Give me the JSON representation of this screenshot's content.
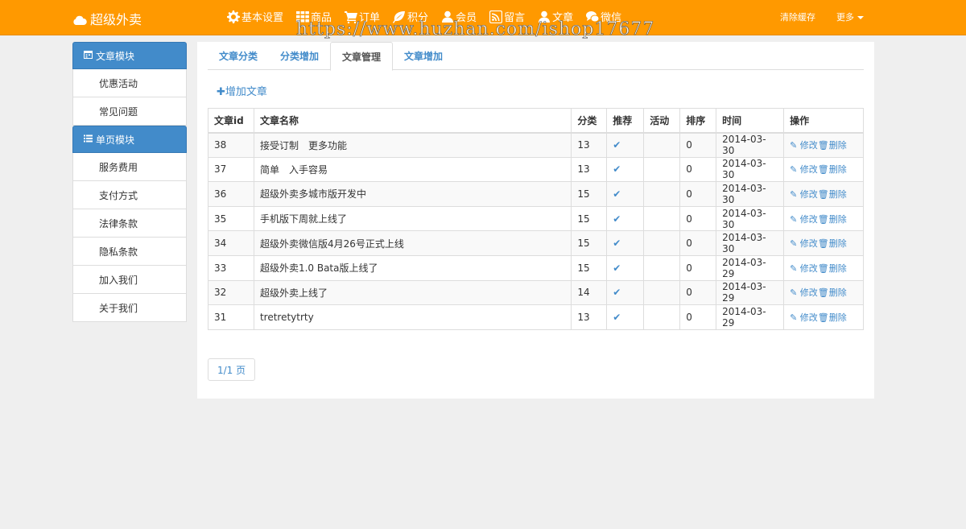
{
  "brand": {
    "name": "超级外卖",
    "icon": "cloud-icon"
  },
  "nav": [
    {
      "label": "基本设置",
      "icon": "gear-icon"
    },
    {
      "label": "商品",
      "icon": "grid-icon"
    },
    {
      "label": "订单",
      "icon": "cart-icon"
    },
    {
      "label": "积分",
      "icon": "leaf-icon"
    },
    {
      "label": "会员",
      "icon": "user-icon"
    },
    {
      "label": "留言",
      "icon": "rss-icon"
    },
    {
      "label": "文章",
      "icon": "user-icon"
    },
    {
      "label": "微信",
      "icon": "chat-icon"
    }
  ],
  "nav_right": {
    "clear_cache": "清除缓存",
    "more": "更多"
  },
  "watermark": "https://www.huzhan.com/ishop17677",
  "sidebar": {
    "group1": {
      "title": "文章模块",
      "icon": "calendar-icon",
      "items": [
        "优惠活动",
        "常见问题"
      ]
    },
    "group2": {
      "title": "单页模块",
      "icon": "list-icon",
      "items": [
        "服务费用",
        "支付方式",
        "法律条款",
        "隐私条款",
        "加入我们",
        "关于我们"
      ]
    }
  },
  "tabs": [
    "文章分类",
    "分类增加",
    "文章管理",
    "文章增加"
  ],
  "active_tab": "文章管理",
  "add_article": "增加文章",
  "table": {
    "headers": [
      "文章id",
      "文章名称",
      "分类",
      "推荐",
      "活动",
      "排序",
      "时间",
      "操作"
    ],
    "rows": [
      {
        "id": "38",
        "name": "接受订制　更多功能",
        "category": "13",
        "recommend": true,
        "activity": "",
        "order": "0",
        "time": "2014-03-30"
      },
      {
        "id": "37",
        "name": "简单　入手容易",
        "category": "13",
        "recommend": true,
        "activity": "",
        "order": "0",
        "time": "2014-03-30"
      },
      {
        "id": "36",
        "name": "超级外卖多城市版开发中",
        "category": "15",
        "recommend": true,
        "activity": "",
        "order": "0",
        "time": "2014-03-30"
      },
      {
        "id": "35",
        "name": "手机版下周就上线了",
        "category": "15",
        "recommend": true,
        "activity": "",
        "order": "0",
        "time": "2014-03-30"
      },
      {
        "id": "34",
        "name": "超级外卖微信版4月26号正式上线",
        "category": "15",
        "recommend": true,
        "activity": "",
        "order": "0",
        "time": "2014-03-30"
      },
      {
        "id": "33",
        "name": "超级外卖1.0 Bata版上线了",
        "category": "15",
        "recommend": true,
        "activity": "",
        "order": "0",
        "time": "2014-03-29"
      },
      {
        "id": "32",
        "name": "超级外卖上线了",
        "category": "14",
        "recommend": true,
        "activity": "",
        "order": "0",
        "time": "2014-03-29"
      },
      {
        "id": "31",
        "name": "tretretytrty",
        "category": "13",
        "recommend": true,
        "activity": "",
        "order": "0",
        "time": "2014-03-29"
      }
    ],
    "op_edit": "修改",
    "op_delete": "删除"
  },
  "pager": "1/1 页",
  "colors": {
    "navbar": "#ff9900",
    "primary": "#428bca"
  }
}
